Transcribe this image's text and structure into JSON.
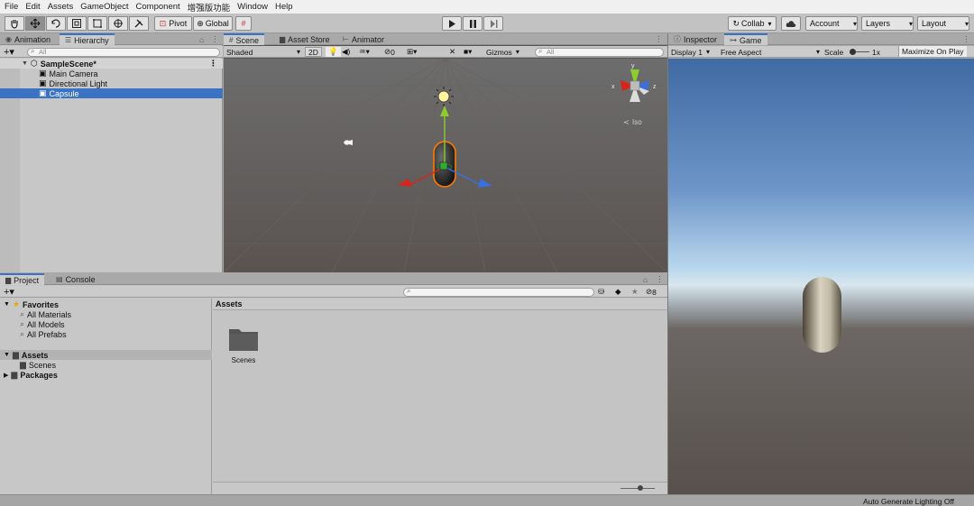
{
  "menu": [
    "File",
    "Edit",
    "Assets",
    "GameObject",
    "Component",
    "增强版功能",
    "Window",
    "Help"
  ],
  "toolbar": {
    "pivot": "Pivot",
    "global": "Global",
    "collab": "Collab",
    "account": "Account",
    "layers": "Layers",
    "layout": "Layout"
  },
  "hierarchy": {
    "tabs": [
      "Animation",
      "Hierarchy"
    ],
    "search_placeholder": "All",
    "scene": "SampleScene*",
    "items": [
      "Main Camera",
      "Directional Light",
      "Capsule"
    ]
  },
  "scene_view": {
    "tabs": [
      "Scene",
      "Asset Store",
      "Animator"
    ],
    "shading": "Shaded",
    "mode_2d": "2D",
    "hidden_count": "0",
    "gizmos": "Gizmos",
    "search_placeholder": "All",
    "iso_label": "Iso",
    "axis_y": "y",
    "axis_x": "x",
    "axis_z": "z"
  },
  "project": {
    "tabs": [
      "Project",
      "Console"
    ],
    "favorites_label": "Favorites",
    "favorites": [
      "All Materials",
      "All Models",
      "All Prefabs"
    ],
    "assets_label": "Assets",
    "assets_children": [
      "Scenes"
    ],
    "packages_label": "Packages",
    "breadcrumb": "Assets",
    "folder_name": "Scenes",
    "hidden_count": "8"
  },
  "game_view": {
    "tabs": [
      "Inspector",
      "Game"
    ],
    "display": "Display 1",
    "aspect": "Free Aspect",
    "scale_label": "Scale",
    "scale_value": "1x",
    "maximize": "Maximize On Play"
  },
  "status": {
    "lighting": "Auto Generate Lighting Off"
  },
  "colors": {
    "selection": "#3a72c4",
    "scene_bg": "#5a5350",
    "sky_top": "#3f6aa2",
    "ground": "#57504d"
  }
}
